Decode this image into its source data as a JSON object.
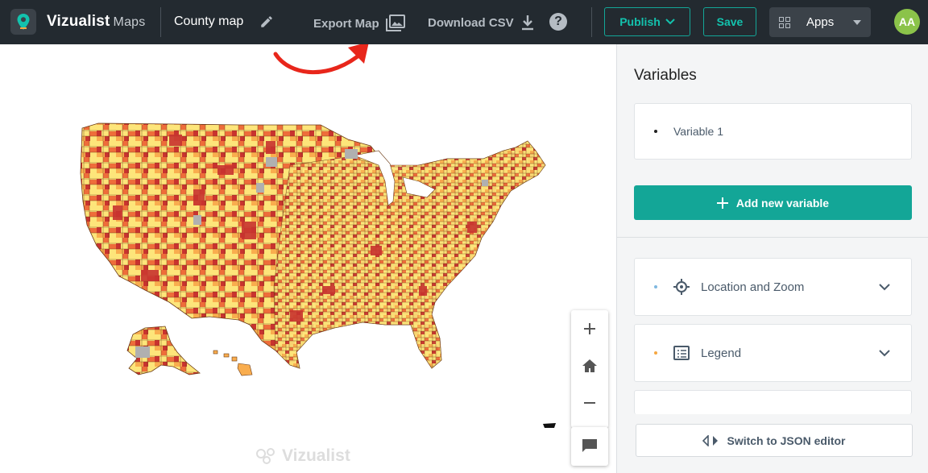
{
  "header": {
    "brand": "Vizualist",
    "brand_sub": "Maps",
    "map_name": "County map",
    "export_label": "Export Map",
    "download_label": "Download CSV",
    "help": "?",
    "publish_label": "Publish",
    "save_label": "Save",
    "apps_label": "Apps",
    "avatar_initials": "AA"
  },
  "colors": {
    "accent": "#13a697",
    "topbar": "#232a30",
    "map_palette": [
      "#fde57a",
      "#f9ad4e",
      "#ee6d3a",
      "#c8332f",
      "#b0b0b0"
    ],
    "annotation_arrow": "#e8261b"
  },
  "map": {
    "watermark": "Vizualist",
    "controls": [
      "plus-icon",
      "home-icon",
      "minus-icon"
    ],
    "chat_icon": "chat-icon"
  },
  "sidebar": {
    "title": "Variables",
    "variables": [
      "Variable 1"
    ],
    "add_variable_label": "Add new variable",
    "sections": [
      {
        "label": "Location and Zoom",
        "icon": "target-icon",
        "dot_color": "#7fb8e0"
      },
      {
        "label": "Legend",
        "icon": "list-icon",
        "dot_color": "#f5a742"
      }
    ],
    "json_editor_label": "Switch to JSON editor"
  }
}
